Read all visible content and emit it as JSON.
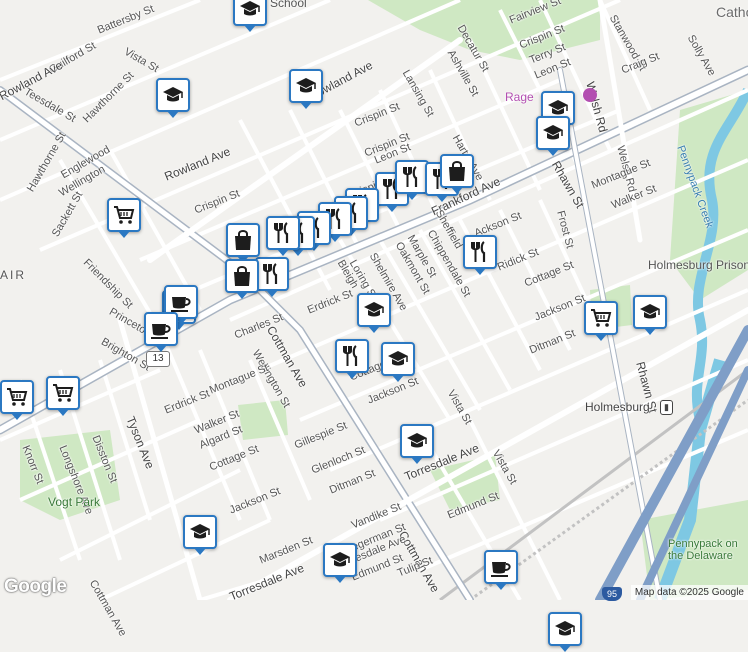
{
  "map": {
    "colors": {
      "background": "#f2f1ee",
      "road": "#ffffff",
      "major_road": "#a9b4c2",
      "park": "#cfe8c3",
      "water": "#7ec8e3",
      "rail": "#c2c2c2",
      "marker_border": "#2b78c2",
      "marker_icon": "#1d1d1d"
    },
    "streets": [
      {
        "name": "Battersby St"
      },
      {
        "name": "Vista St"
      },
      {
        "name": "Guilford St"
      },
      {
        "name": "Teesdale St"
      },
      {
        "name": "Hawthorne St"
      },
      {
        "name": "Rowland Ave"
      },
      {
        "name": "Rowland Ave"
      },
      {
        "name": "Rowland Ave"
      },
      {
        "name": "Crispin St"
      },
      {
        "name": "Crispin St"
      },
      {
        "name": "Crispin St"
      },
      {
        "name": "Englewood"
      },
      {
        "name": "Wellington"
      },
      {
        "name": "Hawthorne St"
      },
      {
        "name": "Sackett St"
      },
      {
        "name": "Friendship St"
      },
      {
        "name": "Princeton"
      },
      {
        "name": "Brighton St"
      },
      {
        "name": "Charles St"
      },
      {
        "name": "Wellington St"
      },
      {
        "name": "Montague St"
      },
      {
        "name": "Erdrick St"
      },
      {
        "name": "Walker St"
      },
      {
        "name": "Algard St"
      },
      {
        "name": "Cottage St"
      },
      {
        "name": "Gillespie St"
      },
      {
        "name": "Jackson St"
      },
      {
        "name": "Glenloch St"
      },
      {
        "name": "Ditman St"
      },
      {
        "name": "Marsden St"
      },
      {
        "name": "Torresdale Ave"
      },
      {
        "name": "Torresdale Ave"
      },
      {
        "name": "Tyson Ave"
      },
      {
        "name": "Disston St"
      },
      {
        "name": "Longshore Ave"
      },
      {
        "name": "Knorr St"
      },
      {
        "name": "Cottman Ave"
      },
      {
        "name": "Cottman Ave"
      },
      {
        "name": "Frankford Ave"
      },
      {
        "name": "Erdrick St"
      },
      {
        "name": "Bleigh"
      },
      {
        "name": "Loring St"
      },
      {
        "name": "Oakmont St"
      },
      {
        "name": "Shelmire Ave"
      },
      {
        "name": "Marple St"
      },
      {
        "name": "Sheffield"
      },
      {
        "name": "Chippendale St"
      },
      {
        "name": "Lansing St"
      },
      {
        "name": "Hartel Ave"
      },
      {
        "name": "Ashville St"
      },
      {
        "name": "Decatur St"
      },
      {
        "name": "Fairview St"
      },
      {
        "name": "Crispin St"
      },
      {
        "name": "Terry St"
      },
      {
        "name": "Leon St"
      },
      {
        "name": "Leon St"
      },
      {
        "name": "Crispin St"
      },
      {
        "name": "Stanwood St"
      },
      {
        "name": "Craig St"
      },
      {
        "name": "Solly Ave"
      },
      {
        "name": "Welsh Rd"
      },
      {
        "name": "Welsh Rd"
      },
      {
        "name": "Rhawn St"
      },
      {
        "name": "Rhawn St"
      },
      {
        "name": "Frost St"
      },
      {
        "name": "Montague St"
      },
      {
        "name": "Walker St"
      },
      {
        "name": "Cottage St"
      },
      {
        "name": "Jackson St"
      },
      {
        "name": "Ditman St"
      },
      {
        "name": "Vista St"
      },
      {
        "name": "Vista St"
      },
      {
        "name": "Jackson St"
      },
      {
        "name": "Cottage"
      },
      {
        "name": "Torresdale Ave"
      },
      {
        "name": "Vandike St"
      },
      {
        "name": "Hegerman St"
      },
      {
        "name": "Edmund St"
      },
      {
        "name": "Edmund St"
      },
      {
        "name": "Tulip St"
      },
      {
        "name": "Cottman Ave"
      },
      {
        "name": "Ackson St"
      },
      {
        "name": "Ridick St"
      },
      {
        "name": "Aker St"
      }
    ],
    "places": [
      {
        "name": "Catho",
        "type": "poi"
      },
      {
        "name": "Rage",
        "type": "poi"
      },
      {
        "name": "Pennypack Creek",
        "type": "water"
      },
      {
        "name": "Holmesburg Prison",
        "type": "poi"
      },
      {
        "name": "Holmesburg",
        "type": "station"
      },
      {
        "name": "Vogt Park",
        "type": "park"
      },
      {
        "name": "Pennypack on the Delaware",
        "type": "park"
      },
      {
        "name": "AIR",
        "type": "neighborhood"
      },
      {
        "name": "School",
        "type": "poi"
      }
    ],
    "markers": [
      {
        "icon": "school-icon"
      },
      {
        "icon": "school-icon"
      },
      {
        "icon": "school-icon"
      },
      {
        "icon": "school-icon"
      },
      {
        "icon": "school-icon"
      },
      {
        "icon": "school-icon"
      },
      {
        "icon": "school-icon"
      },
      {
        "icon": "school-icon"
      },
      {
        "icon": "school-icon"
      },
      {
        "icon": "school-icon"
      },
      {
        "icon": "school-icon"
      },
      {
        "icon": "school-icon"
      },
      {
        "icon": "cart-icon"
      },
      {
        "icon": "cart-icon"
      },
      {
        "icon": "cart-icon"
      },
      {
        "icon": "cart-icon"
      },
      {
        "icon": "cart-icon"
      },
      {
        "icon": "restaurant-icon"
      },
      {
        "icon": "restaurant-icon"
      },
      {
        "icon": "restaurant-icon"
      },
      {
        "icon": "restaurant-icon"
      },
      {
        "icon": "restaurant-icon"
      },
      {
        "icon": "restaurant-icon"
      },
      {
        "icon": "restaurant-icon"
      },
      {
        "icon": "restaurant-icon"
      },
      {
        "icon": "restaurant-icon"
      },
      {
        "icon": "restaurant-icon"
      },
      {
        "icon": "restaurant-icon"
      },
      {
        "icon": "restaurant-icon"
      },
      {
        "icon": "shopping-bag-icon"
      },
      {
        "icon": "shopping-bag-icon"
      },
      {
        "icon": "shopping-bag-icon"
      },
      {
        "icon": "coffee-icon"
      },
      {
        "icon": "coffee-icon"
      },
      {
        "icon": "coffee-icon"
      }
    ],
    "route_shield": "13",
    "interstate_shield": "95",
    "attribution": "Map data ©2025 Google",
    "logo": "Google"
  }
}
